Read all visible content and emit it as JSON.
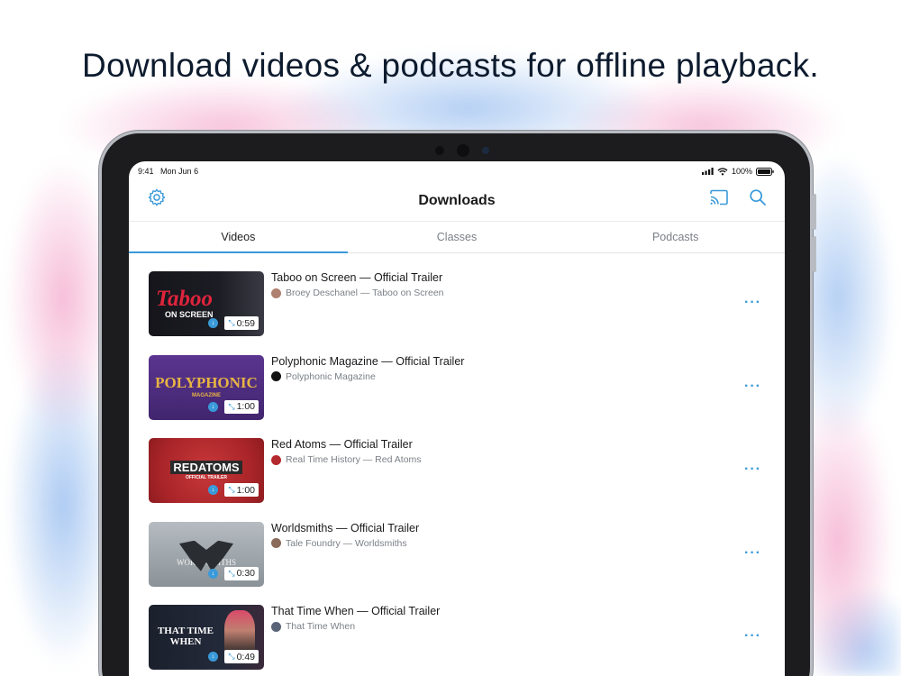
{
  "headline": "Download videos & podcasts for offline playback.",
  "status": {
    "time": "9:41",
    "date": "Mon Jun 6",
    "battery": "100%"
  },
  "nav": {
    "title": "Downloads"
  },
  "tabs": [
    {
      "label": "Videos",
      "active": true
    },
    {
      "label": "Classes",
      "active": false
    },
    {
      "label": "Podcasts",
      "active": false
    }
  ],
  "items": [
    {
      "title": "Taboo on Screen — Official Trailer",
      "subtitle": "Broey Deschanel — Taboo on Screen",
      "duration": "0:59",
      "art_line1": "Taboo",
      "art_line2": "ON SCREEN",
      "colors": {
        "bg": "#14141a",
        "accent": "#e0243c",
        "avatar": "#b08070"
      }
    },
    {
      "title": "Polyphonic Magazine — Official Trailer",
      "subtitle": "Polyphonic Magazine",
      "duration": "1:00",
      "art_line1": "POLYPHONIC",
      "art_line2": "MAGAZINE",
      "colors": {
        "bg": "#4a2b7a",
        "accent": "#e8b444",
        "avatar": "#111111"
      }
    },
    {
      "title": "Red Atoms — Official Trailer",
      "subtitle": "Real Time History — Red Atoms",
      "duration": "1:00",
      "art_line1": "REDATOMS",
      "art_line2": "OFFICIAL TRAILER",
      "colors": {
        "bg": "#b22a2e",
        "accent": "#ffffff",
        "avatar": "#b22a2e"
      }
    },
    {
      "title": "Worldsmiths — Official Trailer",
      "subtitle": "Tale Foundry — Worldsmiths",
      "duration": "0:30",
      "art_line1": "WORLDSMITHS",
      "art_line2": "",
      "colors": {
        "bg": "#8c959c",
        "accent": "#f2f2f2",
        "avatar": "#8a6a5a"
      }
    },
    {
      "title": "That Time When — Official Trailer",
      "subtitle": "That Time When",
      "duration": "0:49",
      "art_line1": "THAT TIME WHEN",
      "art_line2": "",
      "colors": {
        "bg": "#1e2432",
        "accent": "#ffffff",
        "avatar": "#5a6478"
      }
    }
  ],
  "colors": {
    "accent": "#3a9ad9",
    "text": "#1a1a1a",
    "muted": "#7b8087"
  }
}
